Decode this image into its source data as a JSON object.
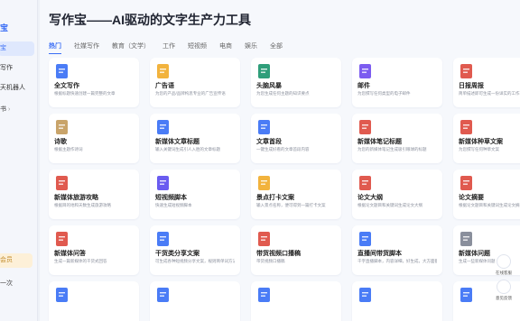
{
  "sidebar": {
    "logo": "宝",
    "items": [
      "写作",
      "天机器人",
      "书"
    ],
    "member": "会员",
    "bottom": "一次"
  },
  "header": {
    "title": "写作宝——AI驱动的文字生产力工具"
  },
  "tabs": [
    "热门",
    "社媒写作",
    "教育（文学）",
    "工作",
    "短视频",
    "电商",
    "娱乐",
    "全部"
  ],
  "cards": [
    {
      "name": "全文写作",
      "desc": "根据标题快速创建一篇完整的文章",
      "icon": "pen-doc-icon",
      "color": "#4a7cf6"
    },
    {
      "name": "广告语",
      "desc": "为您的产品/品牌构思专业的广告宣传语",
      "icon": "folder-icon",
      "color": "#f2b33d"
    },
    {
      "name": "头脑风暴",
      "desc": "为您生成任何主题的知识要点",
      "icon": "chart-icon",
      "color": "#2f9e7a"
    },
    {
      "name": "邮件",
      "desc": "为您撰写任何类型的电子邮件",
      "icon": "mail-icon",
      "color": "#7c5cf0"
    },
    {
      "name": "日报周报",
      "desc": "简单描述即可生成一份详实的工作日报",
      "icon": "report-icon",
      "color": "#e05a4f"
    },
    {
      "name": "诗歌",
      "desc": "根据主题作诗词",
      "icon": "quill-icon",
      "color": "#c9a46a"
    },
    {
      "name": "新媒体文章标题",
      "desc": "输入关键词生成引人入胜的文章标题",
      "icon": "doc-icon",
      "color": "#4a7cf6"
    },
    {
      "name": "文章首段",
      "desc": "一键生成好看的文章首段内容",
      "icon": "docs-icon",
      "color": "#4a7cf6"
    },
    {
      "name": "新媒体笔记标题",
      "desc": "为您的新媒体笔记生成吸引眼球的标题",
      "icon": "note-icon",
      "color": "#e05a4f"
    },
    {
      "name": "新媒体种草文案",
      "desc": "为您撰写任何种草文案",
      "icon": "note-red-icon",
      "color": "#e05a4f"
    },
    {
      "name": "新媒体旅游攻略",
      "desc": "根据目的地和天数生成旅游攻略",
      "icon": "travel-icon",
      "color": "#e05a4f"
    },
    {
      "name": "短视频脚本",
      "desc": "快速生成短视频脚本",
      "icon": "play-icon",
      "color": "#6a5cf0"
    },
    {
      "name": "景点打卡文案",
      "desc": "输入景点名称，便可得到一篇打卡文案",
      "icon": "pin-icon",
      "color": "#f2b33d"
    },
    {
      "name": "论文大纲",
      "desc": "根据论文题目和关键词生成论文大纲",
      "icon": "book-icon",
      "color": "#e05a4f"
    },
    {
      "name": "论文摘要",
      "desc": "根据论文题目和关键词生成论文摘要",
      "icon": "book-red-icon",
      "color": "#e05a4f"
    },
    {
      "name": "新媒体问答",
      "desc": "生成一篇新媒体的干货式回答",
      "icon": "hash-icon",
      "color": "#e05a4f"
    },
    {
      "name": "干货类分享文案",
      "desc": "可生成各种短视频分享文案，规则简单词方法等",
      "icon": "share-icon",
      "color": "#4a7cf6"
    },
    {
      "name": "带货视频口播稿",
      "desc": "带货视频口播稿",
      "icon": "bag-icon",
      "color": "#e05a4f"
    },
    {
      "name": "直播间带货脚本",
      "desc": "千字直播脚本，内容详细，好生成，大方面都！",
      "icon": "live-icon",
      "color": "#4a7cf6"
    },
    {
      "name": "新媒体问题",
      "desc": "生成一些新媒体问题",
      "icon": "question-icon",
      "color": "#8a8f9c"
    },
    {
      "name": "",
      "desc": "",
      "icon": "video-icon",
      "color": "#4a7cf6"
    },
    {
      "name": "",
      "desc": "",
      "icon": "board-icon",
      "color": "#4a7cf6"
    },
    {
      "name": "",
      "desc": "",
      "icon": "code-icon",
      "color": "#4a7cf6"
    },
    {
      "name": "",
      "desc": "",
      "icon": "list-icon",
      "color": "#4a7cf6"
    },
    {
      "name": "",
      "desc": "",
      "icon": "team-icon",
      "color": "#4a7cf6"
    }
  ],
  "float": {
    "btn1": "在线客服",
    "btn2": "意见反馈"
  }
}
